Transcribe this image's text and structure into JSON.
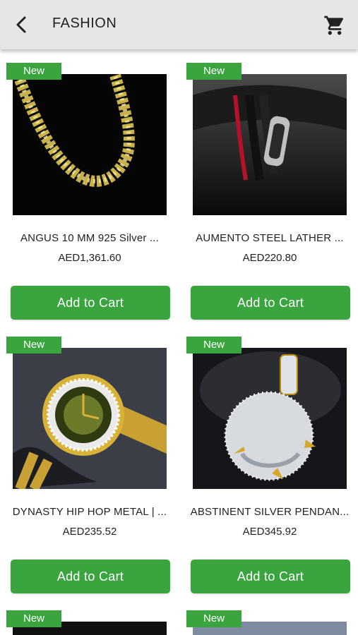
{
  "header": {
    "title": "FASHION",
    "back_icon": "chevron-left-icon",
    "cart_icon": "shopping-cart-icon"
  },
  "products": [
    {
      "badge": "New",
      "name": "ANGUS 10 MM 925 Silver ...",
      "price": "AED1,361.60",
      "button": "Add to Cart",
      "image": "gold-chain-necklace"
    },
    {
      "badge": "New",
      "name": "AUMENTO STEEL LATHER ...",
      "price": "AED220.80",
      "button": "Add to Cart",
      "image": "leather-bracelet"
    },
    {
      "badge": "New",
      "name": "DYNASTY HIP HOP METAL | ...",
      "price": "AED235.52",
      "button": "Add to Cart",
      "image": "gold-watch"
    },
    {
      "badge": "New",
      "name": "ABSTINENT SILVER PENDAN...",
      "price": "AED345.92",
      "button": "Add to Cart",
      "image": "silver-pendant"
    }
  ],
  "partial_products": [
    {
      "badge": "New"
    },
    {
      "badge": "New"
    }
  ],
  "colors": {
    "accent": "#3aa53f",
    "appbar": "#e6e6e6"
  }
}
